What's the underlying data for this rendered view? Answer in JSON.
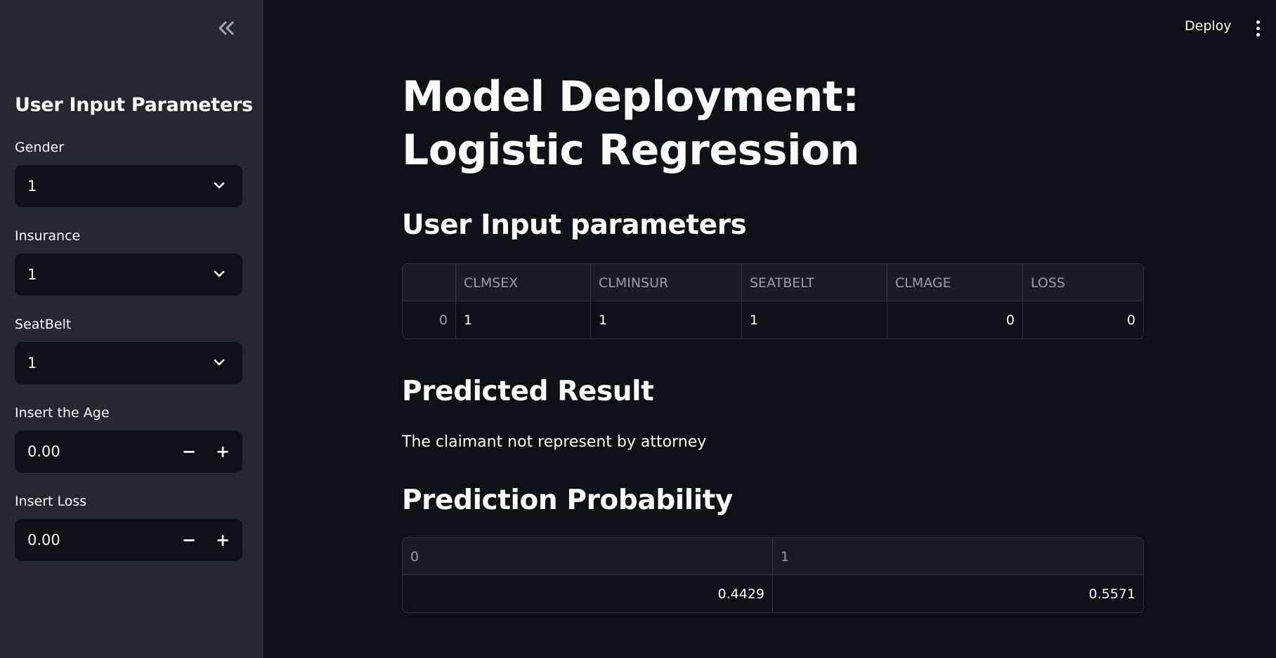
{
  "sidebar": {
    "title": "User Input Parameters",
    "fields": {
      "gender": {
        "label": "Gender",
        "value": "1"
      },
      "insurance": {
        "label": "Insurance",
        "value": "1"
      },
      "seatbelt": {
        "label": "SeatBelt",
        "value": "1"
      },
      "age": {
        "label": "Insert the Age",
        "value": "0.00",
        "minus": "−",
        "plus": "+"
      },
      "loss": {
        "label": "Insert Loss",
        "value": "0.00",
        "minus": "−",
        "plus": "+"
      }
    }
  },
  "header": {
    "deploy_label": "Deploy"
  },
  "main": {
    "title": "Model Deployment: Logistic Regression",
    "input_section_title": "User Input parameters",
    "input_table": {
      "columns": [
        "",
        "CLMSEX",
        "CLMINSUR",
        "SEATBELT",
        "CLMAGE",
        "LOSS"
      ],
      "row": [
        "0",
        "1",
        "1",
        "1",
        "0",
        "0"
      ]
    },
    "result_section_title": "Predicted Result",
    "result_text": "The claimant not represent by attorney",
    "prob_section_title": "Prediction Probability",
    "prob_table": {
      "columns": [
        "0",
        "1"
      ],
      "row": [
        "0.4429",
        "0.5571"
      ]
    }
  },
  "colors": {
    "background": "#0e1117",
    "sidebar": "#262730",
    "text": "#fafafa",
    "muted": "#9a9ca5",
    "border": "#31333f"
  },
  "icons": {
    "collapse": "double-chevron-left-icon",
    "select": "chevron-down-icon",
    "menu": "kebab-menu-icon"
  }
}
